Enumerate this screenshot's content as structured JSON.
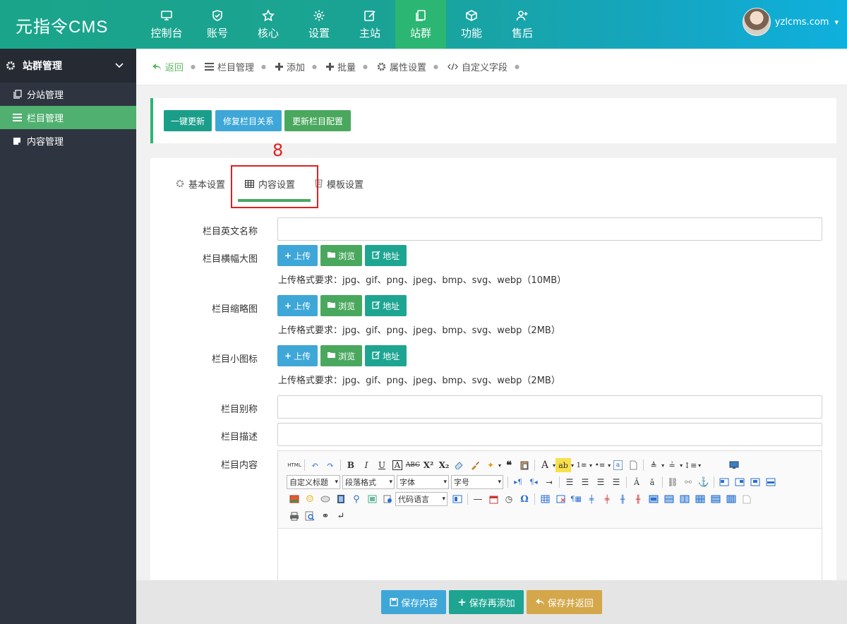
{
  "app": {
    "logo": "元指令CMS",
    "user": "yzlcms.com"
  },
  "nav": [
    {
      "label": "控制台",
      "icon": "monitor-icon",
      "active": false
    },
    {
      "label": "账号",
      "icon": "shield-icon",
      "active": false
    },
    {
      "label": "核心",
      "icon": "star-icon",
      "active": false
    },
    {
      "label": "设置",
      "icon": "gear-icon",
      "active": false
    },
    {
      "label": "主站",
      "icon": "edit-icon",
      "active": false
    },
    {
      "label": "站群",
      "icon": "copy-icon",
      "active": true
    },
    {
      "label": "功能",
      "icon": "cube-icon",
      "active": false
    },
    {
      "label": "售后",
      "icon": "user-plus-icon",
      "active": false
    }
  ],
  "sidebar": {
    "title": "站群管理",
    "items": [
      {
        "label": "分站管理"
      },
      {
        "label": "栏目管理"
      },
      {
        "label": "内容管理"
      }
    ]
  },
  "crumbs": [
    "返回",
    "栏目管理",
    "添加",
    "批量",
    "属性设置",
    "自定义字段"
  ],
  "actions": {
    "b1": "一键更新",
    "b2": "修复栏目关系",
    "b3": "更新栏目配置"
  },
  "annotation": "8",
  "tabs": [
    "基本设置",
    "内容设置",
    "模板设置"
  ],
  "form": {
    "en_name": "栏目英文名称",
    "banner": "栏目横幅大图",
    "thumb": "栏目缩略图",
    "icon": "栏目小图标",
    "alias": "栏目别称",
    "desc": "栏目描述",
    "content": "栏目内容",
    "upload": "上传",
    "browse": "浏览",
    "addr": "地址",
    "hint1": "上传格式要求：jpg、gif、png、jpeg、bmp、svg、webp（10MB）",
    "hint2": "上传格式要求：jpg、gif、png、jpeg、bmp、svg、webp（2MB）",
    "hint3": "上传格式要求：jpg、gif、png、jpeg、bmp、svg、webp（2MB）"
  },
  "editor": {
    "html": "HTML",
    "custom_title": "自定义标题",
    "para": "段落格式",
    "font": "字体",
    "size": "字号",
    "code": "代码语言"
  },
  "bottom": {
    "save": "保存内容",
    "save_add": "保存再添加",
    "save_back": "保存并返回"
  },
  "colors": {
    "accent": "#2bb673",
    "sidebar": "#2f3540",
    "annotation": "#e02020"
  }
}
